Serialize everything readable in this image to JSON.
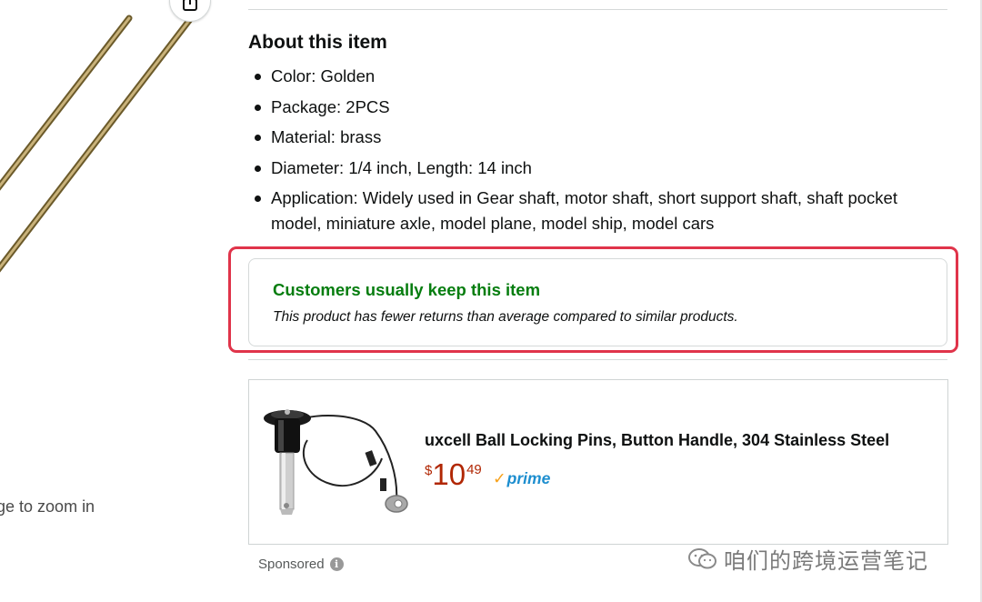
{
  "image_pane": {
    "zoom_hint": "age to zoom in"
  },
  "about": {
    "title": "About this item",
    "bullets": [
      "Color: Golden",
      "Package: 2PCS",
      "Material: brass",
      "Diameter: 1/4 inch, Length: 14 inch",
      "Application: Widely used in Gear shaft, motor shaft, short support shaft, shaft pocket model, miniature axle, model plane, model ship, model cars"
    ]
  },
  "keep_notice": {
    "title": "Customers usually keep this item",
    "description": "This product has fewer returns than average compared to similar products."
  },
  "sponsored_ad": {
    "title": "uxcell Ball Locking Pins, Button Handle, 304 Stainless Steel",
    "price_symbol": "$",
    "price_whole": "10",
    "price_fraction": "49",
    "prime_label": "prime",
    "sponsored_label": "Sponsored",
    "info_glyph": "i"
  },
  "watermark": {
    "text": "咱们的跨境运营笔记"
  },
  "colors": {
    "keep_title": "#067d0f",
    "price": "#b12704",
    "prime": "#1d8ecf",
    "highlight_border": "#e0344a"
  },
  "icons": [
    "share-icon",
    "info-icon",
    "wechat-icon",
    "prime-check-icon"
  ]
}
